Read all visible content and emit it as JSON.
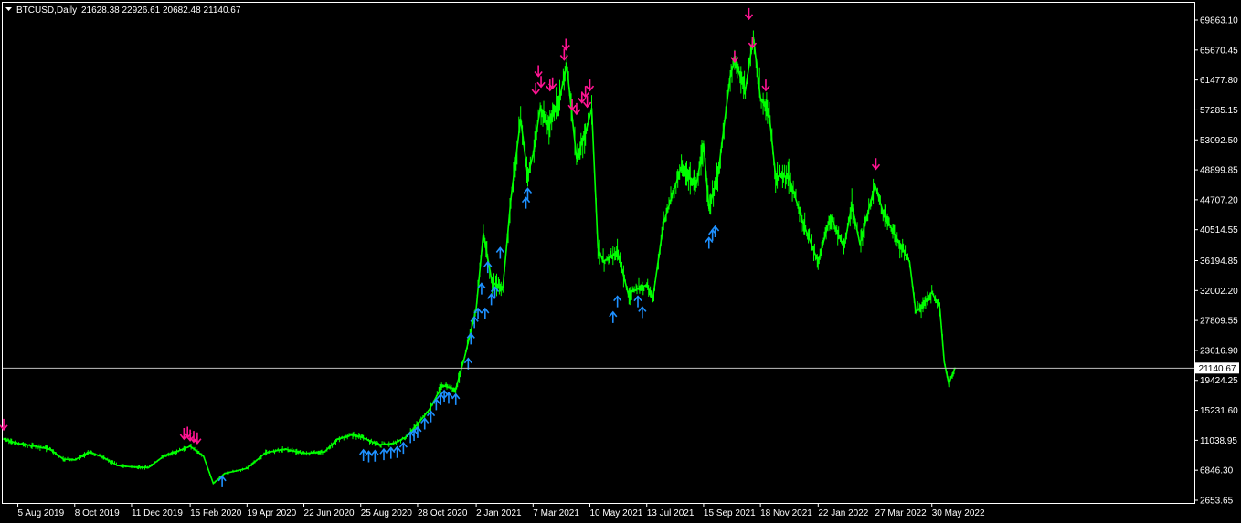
{
  "header": {
    "symbol": "BTCUSD,Daily",
    "ohlc": "21628.38 22926.61 20682.48 21140.67"
  },
  "colors": {
    "background": "#000000",
    "price_line": "#00ff00",
    "buy_arrow": "#1e90ff",
    "sell_arrow": "#ff1493",
    "frame": "#ffffff",
    "current_price_line": "#c0c0c0"
  },
  "chart_data": {
    "type": "line",
    "title": "BTCUSD,Daily",
    "grid": false,
    "ylim": [
      2653.65,
      71000
    ],
    "y_tick_labels": [
      "69863.10",
      "65670.45",
      "61477.80",
      "57285.15",
      "53092.50",
      "48899.85",
      "44707.20",
      "40514.55",
      "36194.85",
      "32002.20",
      "27809.55",
      "23616.90",
      "19424.25",
      "15231.60",
      "11038.95",
      "6846.30",
      "2653.65"
    ],
    "x_tick_labels": [
      "5 Aug 2019",
      "8 Oct 2019",
      "11 Dec 2019",
      "15 Feb 2020",
      "19 Apr 2020",
      "22 Jun 2020",
      "25 Aug 2020",
      "28 Oct 2020",
      "2 Jan 2021",
      "7 Mar 2021",
      "10 May 2021",
      "13 Jul 2021",
      "15 Sep 2021",
      "18 Nov 2021",
      "22 Jan 2022",
      "27 Mar 2022",
      "30 May 2022"
    ],
    "current_price": 21140.67,
    "current_price_label": "21140.67",
    "series": [
      {
        "x": [
          "2019-07-20",
          "2019-08-05",
          "2019-08-20",
          "2019-09-10",
          "2019-09-25",
          "2019-10-08",
          "2019-10-25",
          "2019-11-10",
          "2019-11-25",
          "2019-12-11",
          "2019-12-30",
          "2020-01-15",
          "2020-02-01",
          "2020-02-15",
          "2020-03-01",
          "2020-03-12",
          "2020-03-25",
          "2020-04-19",
          "2020-05-10",
          "2020-06-01",
          "2020-06-22",
          "2020-07-15",
          "2020-07-30",
          "2020-08-15",
          "2020-08-25",
          "2020-09-15",
          "2020-10-01",
          "2020-10-15",
          "2020-10-28",
          "2020-11-10",
          "2020-11-25",
          "2020-12-10",
          "2020-12-20",
          "2021-01-02",
          "2021-01-10",
          "2021-01-20",
          "2021-02-01",
          "2021-02-10",
          "2021-02-21",
          "2021-03-01",
          "2021-03-07",
          "2021-03-15",
          "2021-03-25",
          "2021-04-05",
          "2021-04-14",
          "2021-04-25",
          "2021-05-05",
          "2021-05-12",
          "2021-05-19",
          "2021-05-25",
          "2021-06-10",
          "2021-06-22",
          "2021-07-13",
          "2021-07-20",
          "2021-08-01",
          "2021-08-20",
          "2021-09-07",
          "2021-09-15",
          "2021-09-21",
          "2021-10-01",
          "2021-10-15",
          "2021-10-20",
          "2021-11-01",
          "2021-11-10",
          "2021-11-18",
          "2021-11-28",
          "2021-12-05",
          "2021-12-20",
          "2022-01-05",
          "2022-01-22",
          "2022-02-05",
          "2022-02-20",
          "2022-03-01",
          "2022-03-10",
          "2022-03-27",
          "2022-04-05",
          "2022-04-25",
          "2022-05-05",
          "2022-05-12",
          "2022-05-20",
          "2022-05-30",
          "2022-06-08",
          "2022-06-13",
          "2022-06-18",
          "2022-06-25"
        ],
        "values": [
          11200,
          10600,
          10300,
          9800,
          8400,
          8300,
          9400,
          8600,
          7500,
          7300,
          7200,
          8700,
          9500,
          10200,
          8800,
          5000,
          6400,
          7100,
          9300,
          9800,
          9200,
          9400,
          11200,
          11800,
          11500,
          10400,
          10600,
          11500,
          13300,
          15300,
          18700,
          18200,
          22700,
          29500,
          40000,
          33000,
          32500,
          44800,
          56000,
          48000,
          51000,
          57500,
          55000,
          58500,
          63500,
          50500,
          54000,
          57500,
          38000,
          36000,
          37500,
          31600,
          32800,
          31000,
          41500,
          49000,
          47000,
          52500,
          43500,
          48000,
          62000,
          64200,
          60000,
          67500,
          59000,
          56500,
          48000,
          48000,
          41500,
          36000,
          42500,
          38000,
          44000,
          38500,
          46800,
          43000,
          38200,
          36000,
          29000,
          30000,
          31800,
          29500,
          22000,
          19000,
          21140
        ]
      }
    ],
    "buy_signals": [
      {
        "x": "2020-03-22",
        "y": 6500
      },
      {
        "x": "2020-08-28",
        "y": 10200
      },
      {
        "x": "2020-09-03",
        "y": 10000
      },
      {
        "x": "2020-09-10",
        "y": 10100
      },
      {
        "x": "2020-09-20",
        "y": 10300
      },
      {
        "x": "2020-09-28",
        "y": 10500
      },
      {
        "x": "2020-10-05",
        "y": 10600
      },
      {
        "x": "2020-10-12",
        "y": 11200
      },
      {
        "x": "2020-10-20",
        "y": 12700
      },
      {
        "x": "2020-10-24",
        "y": 13000
      },
      {
        "x": "2020-10-28",
        "y": 13400
      },
      {
        "x": "2020-11-05",
        "y": 14600
      },
      {
        "x": "2020-11-12",
        "y": 15600
      },
      {
        "x": "2020-11-18",
        "y": 17300
      },
      {
        "x": "2020-11-23",
        "y": 18000
      },
      {
        "x": "2020-11-27",
        "y": 18500
      },
      {
        "x": "2020-12-02",
        "y": 18200
      },
      {
        "x": "2020-12-10",
        "y": 18000
      },
      {
        "x": "2020-12-24",
        "y": 23000
      },
      {
        "x": "2020-12-27",
        "y": 26500
      },
      {
        "x": "2020-12-31",
        "y": 28800
      },
      {
        "x": "2021-01-04",
        "y": 30000
      },
      {
        "x": "2021-01-08",
        "y": 33500
      },
      {
        "x": "2021-01-12",
        "y": 30000
      },
      {
        "x": "2021-01-15",
        "y": 36500
      },
      {
        "x": "2021-01-19",
        "y": 32000
      },
      {
        "x": "2021-01-23",
        "y": 33000
      },
      {
        "x": "2021-01-29",
        "y": 38500
      },
      {
        "x": "2021-02-27",
        "y": 45500
      },
      {
        "x": "2021-03-01",
        "y": 46800
      },
      {
        "x": "2021-06-05",
        "y": 29500
      },
      {
        "x": "2021-06-10",
        "y": 31700
      },
      {
        "x": "2021-07-03",
        "y": 31700
      },
      {
        "x": "2021-07-08",
        "y": 30200
      },
      {
        "x": "2021-09-21",
        "y": 39900
      },
      {
        "x": "2021-09-25",
        "y": 41000
      },
      {
        "x": "2021-09-28",
        "y": 41500
      }
    ],
    "sell_signals": [
      {
        "x": "2019-07-20",
        "y": 12000
      },
      {
        "x": "2020-02-08",
        "y": 10700
      },
      {
        "x": "2020-02-12",
        "y": 10900
      },
      {
        "x": "2020-02-15",
        "y": 10500
      },
      {
        "x": "2020-02-19",
        "y": 10300
      },
      {
        "x": "2020-02-23",
        "y": 10100
      },
      {
        "x": "2021-03-10",
        "y": 59000
      },
      {
        "x": "2021-03-13",
        "y": 61500
      },
      {
        "x": "2021-03-16",
        "y": 60000
      },
      {
        "x": "2021-03-26",
        "y": 59500
      },
      {
        "x": "2021-03-29",
        "y": 59800
      },
      {
        "x": "2021-04-11",
        "y": 63800
      },
      {
        "x": "2021-04-13",
        "y": 65200
      },
      {
        "x": "2021-04-20",
        "y": 56800
      },
      {
        "x": "2021-04-25",
        "y": 56200
      },
      {
        "x": "2021-05-01",
        "y": 57800
      },
      {
        "x": "2021-05-05",
        "y": 58600
      },
      {
        "x": "2021-05-07",
        "y": 57200
      },
      {
        "x": "2021-05-10",
        "y": 59500
      },
      {
        "x": "2021-10-20",
        "y": 63500
      },
      {
        "x": "2021-11-05",
        "y": 69500
      },
      {
        "x": "2021-11-09",
        "y": 65500
      },
      {
        "x": "2021-11-24",
        "y": 59500
      },
      {
        "x": "2022-03-28",
        "y": 48500
      }
    ]
  }
}
